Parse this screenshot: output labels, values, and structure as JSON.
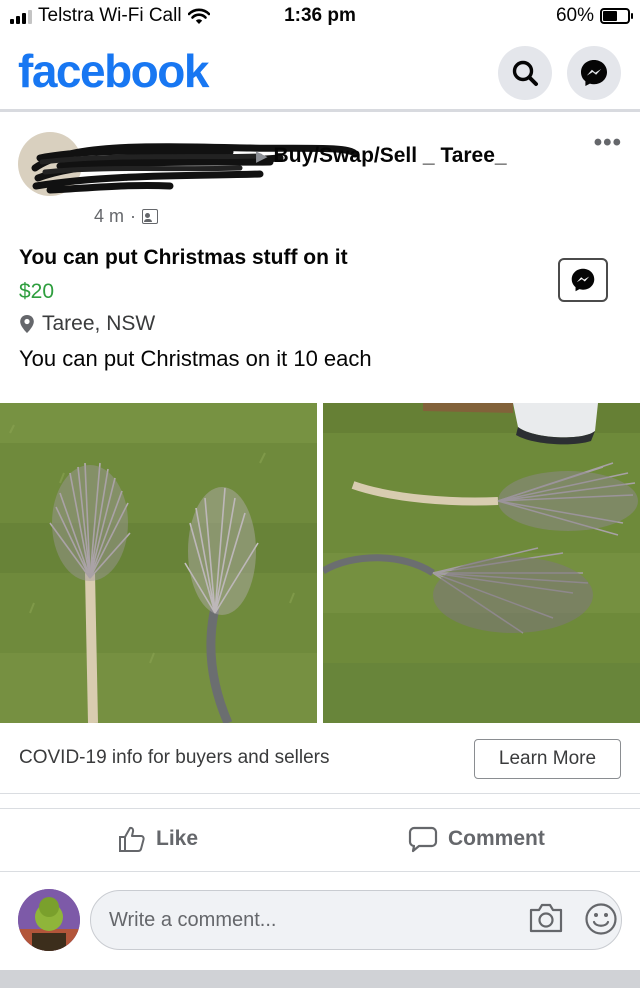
{
  "status_bar": {
    "carrier": "Telstra Wi-Fi Call",
    "time": "1:36 pm",
    "battery": "60%",
    "battery_level": 0.6
  },
  "header": {
    "brand": "facebook",
    "search_icon": "search-icon",
    "messenger_icon": "messenger-icon"
  },
  "post": {
    "group_path": "Buy/Swap/Sell _ Taree_",
    "time_ago": "4 m",
    "separator": "·",
    "more": "•••"
  },
  "listing": {
    "title": "You can put Christmas stuff on it",
    "price": "$20",
    "location": "Taree, NSW",
    "description": "You can put Christmas on it 10 each"
  },
  "covid": {
    "text": "COVID-19 info for buyers and sellers",
    "button": "Learn More"
  },
  "actions": {
    "like": "Like",
    "comment": "Comment"
  },
  "comment_box": {
    "placeholder": "Write a comment..."
  },
  "colors": {
    "brand": "#1877f2",
    "price": "#2e9e3e",
    "secondary_text": "#65676b"
  }
}
